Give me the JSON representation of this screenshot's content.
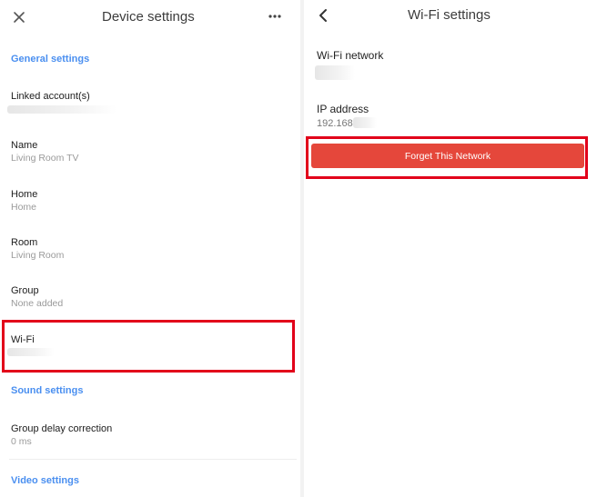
{
  "left": {
    "header": {
      "title": "Device settings",
      "close_icon": "close-icon",
      "more_icon": "more-horizontal-icon"
    },
    "sections": {
      "general": "General settings",
      "sound": "Sound settings",
      "video": "Video settings"
    },
    "rows": {
      "linked_accounts": {
        "label": "Linked account(s)"
      },
      "name": {
        "label": "Name",
        "value": "Living Room TV"
      },
      "home": {
        "label": "Home",
        "value": "Home"
      },
      "room": {
        "label": "Room",
        "value": "Living Room"
      },
      "group": {
        "label": "Group",
        "value": "None added"
      },
      "wifi": {
        "label": "Wi-Fi"
      },
      "group_delay": {
        "label": "Group delay correction",
        "value": "0 ms"
      }
    },
    "highlight_color": "#e2001a"
  },
  "right": {
    "header": {
      "title": "Wi-Fi settings",
      "back_icon": "chevron-left-icon"
    },
    "wifi_network": {
      "label": "Wi-Fi network"
    },
    "ip_address": {
      "label": "IP address",
      "value": "192.168."
    },
    "forget_button": {
      "label": "Forget This Network",
      "color": "#e5473b"
    }
  }
}
